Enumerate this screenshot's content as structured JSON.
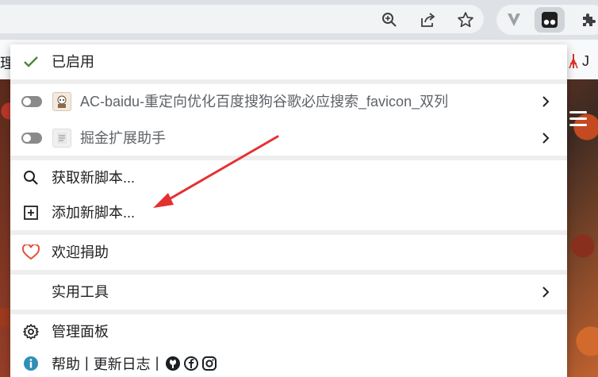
{
  "browser": {
    "toolbar_icons": [
      "zoom-icon",
      "share-icon",
      "bookmark-star-icon",
      "vivaldi-extension-icon",
      "tampermonkey-icon",
      "extensions-puzzle-icon"
    ],
    "bookmarks_bar": {
      "left_text": "理",
      "right_text": "J"
    }
  },
  "menu": {
    "enabled": {
      "label": "已启用",
      "icon": "checkmark-icon",
      "color": "#4a8a3a"
    },
    "scripts": [
      {
        "name": "AC-baidu-重定向优化百度搜狗谷歌必应搜索_favicon_双列",
        "enabled": false,
        "favicon": "ac-baidu-favicon"
      },
      {
        "name": "掘金扩展助手",
        "enabled": false,
        "favicon": "juejin-favicon"
      }
    ],
    "actions": {
      "get_new": {
        "label": "获取新脚本...",
        "icon": "search-icon"
      },
      "add_new": {
        "label": "添加新脚本...",
        "icon": "plus-square-icon"
      }
    },
    "donate": {
      "label": "欢迎捐助",
      "icon": "heart-icon",
      "color": "#e0533a"
    },
    "utilities": {
      "label": "实用工具"
    },
    "dashboard": {
      "label": "管理面板",
      "icon": "gear-icon"
    },
    "footer": {
      "help": "帮助",
      "separator": "|",
      "changelog": "更新日志",
      "icon": "info-icon",
      "info_color": "#2f8fb8",
      "social_icons": [
        "github-icon",
        "facebook-icon",
        "instagram-icon"
      ]
    }
  },
  "annotation": {
    "arrow_color": "#e53030"
  }
}
